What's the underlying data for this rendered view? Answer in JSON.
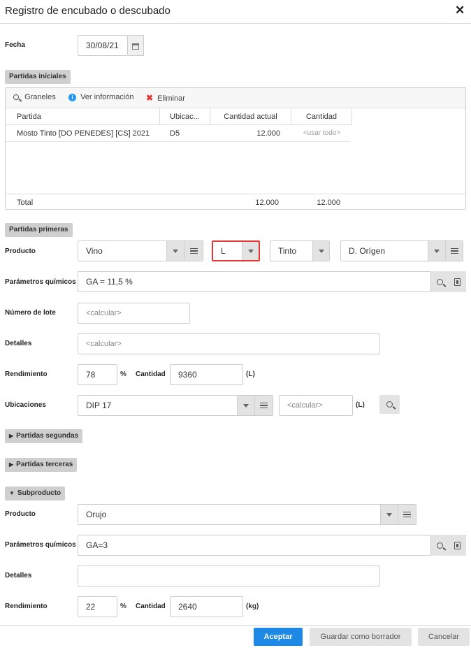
{
  "dialog": {
    "title": "Registro de encubado o descubado",
    "close_symbol": "✕"
  },
  "fecha": {
    "label": "Fecha",
    "value": "30/08/21",
    "icon": "calendar-icon"
  },
  "partidas_iniciales": {
    "section_label": "Partidas iníciales",
    "toolbar": {
      "graneles": "Graneles",
      "ver_informacion": "Ver información",
      "eliminar": "Eliminar"
    },
    "columns": [
      "Partida",
      "Ubicac...",
      "Cantidad actual",
      "Cantidad"
    ],
    "rows": [
      {
        "partida": "Mosto Tinto [DO PENEDES] [CS] 2021",
        "ubicacion": "D5",
        "cantidad_actual": "12.000",
        "cantidad": "<usar todo>"
      }
    ],
    "total": {
      "label": "Total",
      "cantidad_actual": "12.000",
      "cantidad": "12.000"
    }
  },
  "partidas_primeras": {
    "section_label": "Partidas primeras",
    "producto_label": "Producto",
    "producto_value": "Vino",
    "unidad_value": "L",
    "color_value": "Tinto",
    "origen_value": "D. Orígen",
    "parametros_label": "Parámetros químicos",
    "parametros_value": "GA  = 11,5 %",
    "lote_label": "Número de lote",
    "lote_placeholder": "<calcular>",
    "detalles_label": "Detalles",
    "detalles_placeholder": "<calcular>",
    "rendimiento_label": "Rendimiento",
    "rendimiento_value": "78",
    "percent_unit": "%",
    "cantidad_label": "Cantidad",
    "cantidad_value": "9360",
    "cantidad_unit": "(L)",
    "ubicaciones_label": "Ubicaciones",
    "ubicaciones_value": "DIP 17",
    "ubicaciones_qty_placeholder": "<calcular>",
    "ubicaciones_unit": "(L)"
  },
  "partidas_segundas": {
    "section_label": "Partidas segundas"
  },
  "partidas_terceras": {
    "section_label": "Partidas terceras"
  },
  "subproducto": {
    "section_label": "Subproducto",
    "producto_label": "Producto",
    "producto_value": "Orujo",
    "parametros_label": "Parámetros químicos",
    "parametros_value": "GA=3",
    "detalles_label": "Detalles",
    "detalles_value": "",
    "rendimiento_label": "Rendimiento",
    "rendimiento_value": "22",
    "percent_unit": "%",
    "cantidad_label": "Cantidad",
    "cantidad_value": "2640",
    "cantidad_unit": "(kg)"
  },
  "footer": {
    "aceptar": "Aceptar",
    "guardar": "Guardar como borrador",
    "cancelar": "Cancelar"
  },
  "colors": {
    "primary": "#1e88e5",
    "highlight_border": "#e53935",
    "info_icon": "#2196f3",
    "delete_icon": "#e53935"
  }
}
